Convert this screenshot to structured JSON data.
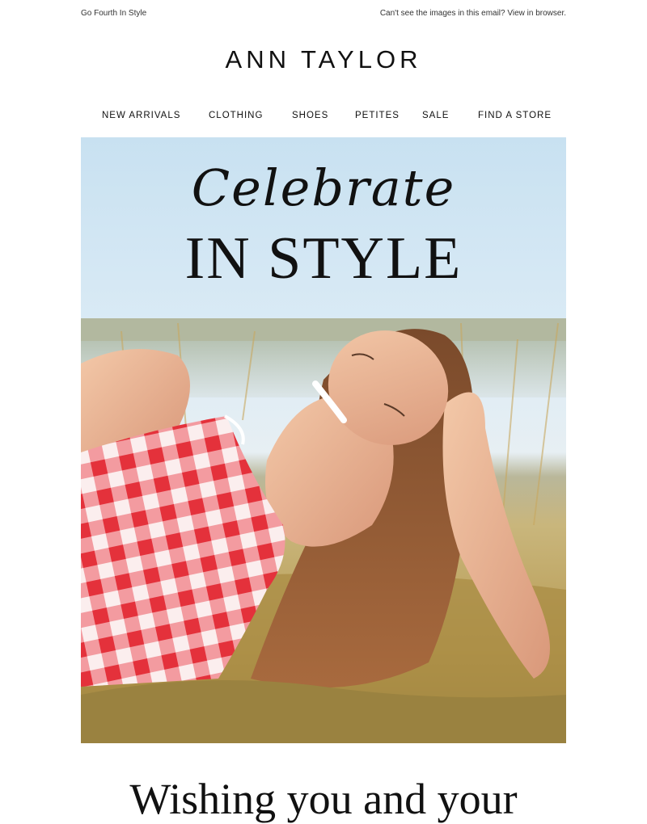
{
  "preheader": {
    "left_text": "Go Fourth In Style",
    "right_text": "Can't see the images in this email? View in browser."
  },
  "brand": {
    "logo_text": "ANN TAYLOR"
  },
  "nav": {
    "items": [
      {
        "label": "NEW ARRIVALS"
      },
      {
        "label": "CLOTHING"
      },
      {
        "label": "SHOES"
      },
      {
        "label": "PETITES"
      },
      {
        "label": "SALE"
      },
      {
        "label": "FIND A STORE"
      }
    ]
  },
  "hero": {
    "headline_script": "Celebrate",
    "headline_main": "IN STYLE",
    "image_subject": "woman-in-gingham-top-lying-on-grass"
  },
  "body": {
    "headline": "Wishing you and your"
  },
  "colors": {
    "gingham_red": "#e8323c",
    "sky": "#cfe4f2",
    "grass": "#b89c55"
  }
}
